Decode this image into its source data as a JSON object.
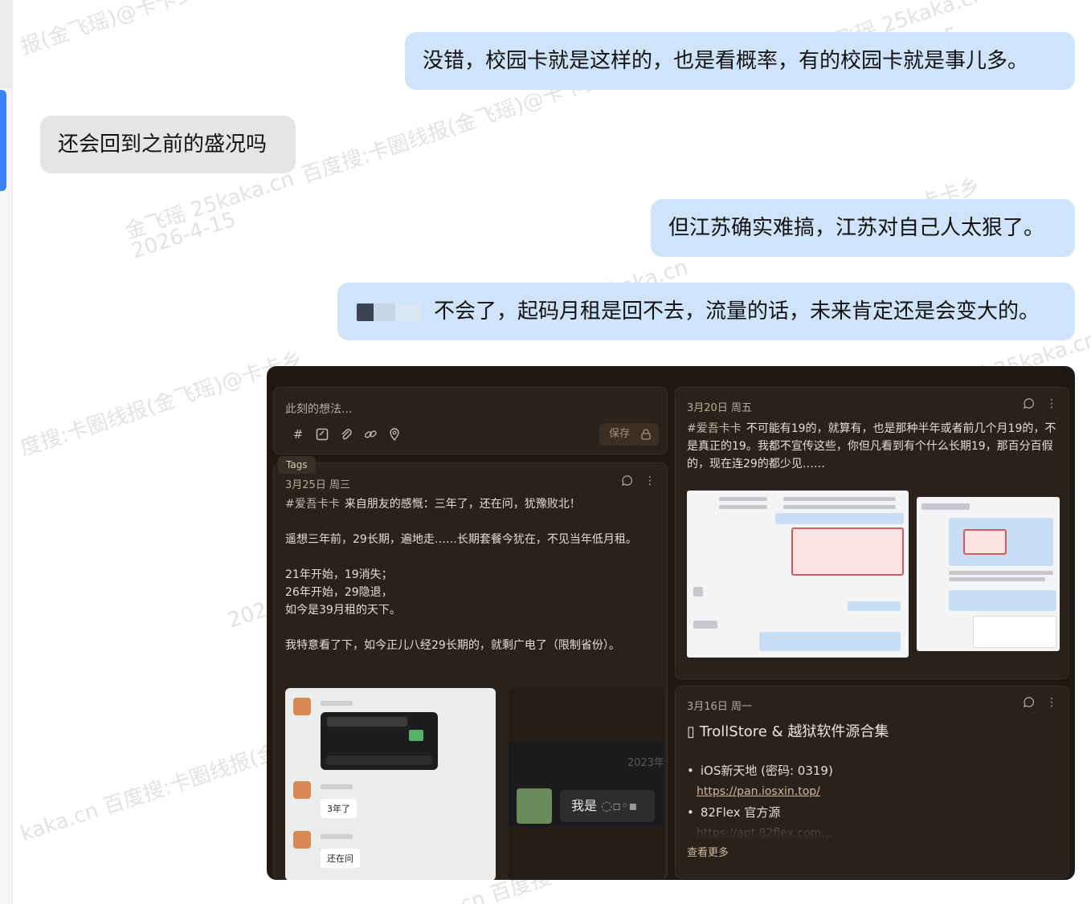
{
  "watermarks": [
    "报(金飞瑶)@卡卡乡",
    "金飞瑶 25kaka.cn",
    "2026-4-15",
    "百度搜:卡圈线报(金飞瑶)@卡卡乡",
    "金飞瑶 25kaka.cn",
    "2026-4-15",
    "金飞瑶)@卡卡乡",
    "金飞瑶 25kaka.cn",
    "度搜:卡圈线报(金飞瑶)@卡卡乡",
    "金飞瑶 25kaka.cn",
    "2026-4-15",
    "kaka.cn 百度搜:卡圈线报(金飞瑶)@卡卡乡",
    "25kaka.cn 百度搜"
  ],
  "chat": {
    "msg1": "没错，校园卡就是这样的，也是看概率，有的校园卡就是事儿多。",
    "msg2": "还会回到之前的盛况吗",
    "msg3": "但江苏确实难搞，江苏对自己人太狠了。",
    "msg4": "不会了，起码月租是回不去，流量的话，未来肯定还是会变大的。"
  },
  "notes_app": {
    "composer": {
      "placeholder": "此刻的想法...",
      "save_label": "保存",
      "tags_tooltip": "Tags",
      "tool_icons": [
        "hash-icon",
        "checkbox-icon",
        "paperclip-icon",
        "link-icon",
        "location-pin-icon"
      ]
    },
    "note1": {
      "date": "3月25日 周三",
      "tag": "#爱吾卡卡",
      "lines": [
        "来自朋友的感慨：三年了，还在问，犹豫败北！",
        "",
        "遥想三年前，29长期，遍地走……长期套餐今犹在，不见当年低月租。",
        "",
        "21年开始，19消失；",
        "26年开始，29隐退，",
        "如今是39月租的天下。",
        "",
        "我特意看了下，如今正儿八经29长期的，就剩广电了（限制省份）。"
      ],
      "chat_thumb": {
        "reply_1": "3年了",
        "reply_2": "还在问"
      },
      "dark_thumb": {
        "year": "2023年",
        "bubble": "我是"
      }
    },
    "note2": {
      "date": "3月20日 周五",
      "tag": "#爱吾卡卡",
      "text": "不可能有19的，就算有，也是那种半年或者前几个月19的，不是真正的19。我都不宣传这些，你但凡看到有个什么长期19，那百分百假的，现在连29的都少见……"
    },
    "note3": {
      "date": "3月16日 周一",
      "title": "TrollStore & 越狱软件源合集",
      "items": [
        {
          "label": "iOS新天地 (密码: 0319)",
          "link": "https://pan.iosxin.top/"
        },
        {
          "label": "82Flex 官方源",
          "link": "https://apt.82flex.com…"
        }
      ],
      "more": "查看更多"
    }
  },
  "colors": {
    "bubble_out": "#cfe4fb",
    "bubble_in": "#e5e5e8",
    "notes_bg": "#201813",
    "accent": "#3b82f6"
  }
}
